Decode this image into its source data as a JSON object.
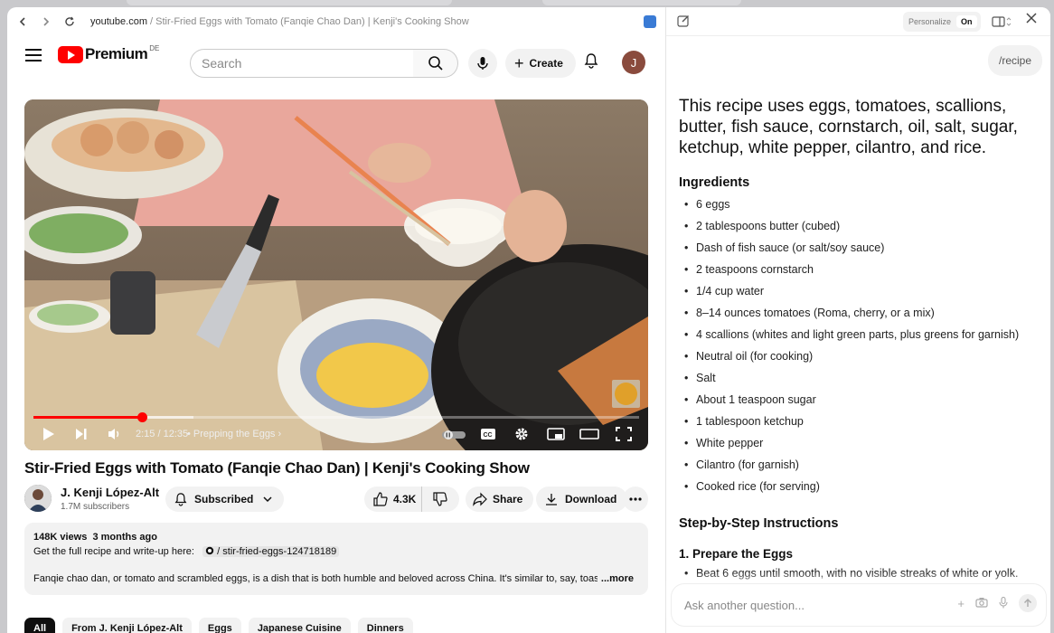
{
  "browser": {
    "url_host": "youtube.com",
    "url_path": " / Stir-Fried Eggs with Tomato (Fanqie Chao Dan) | Kenji's Cooking Show"
  },
  "youtube": {
    "brand": "Premium",
    "country": "DE",
    "search_placeholder": "Search",
    "create_label": "Create",
    "avatar_letter": "J",
    "player": {
      "time": "2:15 / 12:35",
      "chapter": "Prepping the Eggs",
      "progress_fraction": 0.179
    },
    "video_title": "Stir-Fried Eggs with Tomato (Fanqie Chao Dan) | Kenji's Cooking Show",
    "channel": {
      "name": "J. Kenji López-Alt",
      "subscribers": "1.7M subscribers",
      "subscribed_label": "Subscribed"
    },
    "actions": {
      "likes": "4.3K",
      "share": "Share",
      "download": "Download"
    },
    "description": {
      "views": "148K views",
      "age": "3 months ago",
      "line2_prefix": "Get the full recipe and write-up here:",
      "link": "/ stir-fried-eggs-124718189",
      "line3": "Fanqie chao dan, or tomato and scrambled eggs, is a dish that is both humble and beloved across China. It's similar to, say, toast in",
      "more": "...more"
    },
    "chips": [
      "All",
      "From J. Kenji López-Alt",
      "Eggs",
      "Japanese Cuisine",
      "Dinners"
    ]
  },
  "panel": {
    "personalize_label": "Personalize",
    "personalize_state": "On",
    "user_query": "/recipe",
    "answer": "This recipe uses eggs, tomatoes, scallions, butter, fish sauce, cornstarch, oil, salt, sugar, ketchup, white pepper, cilantro, and rice.",
    "ingredients_heading": "Ingredients",
    "ingredients": [
      "6 eggs",
      "2 tablespoons butter (cubed)",
      "Dash of fish sauce (or salt/soy sauce)",
      "2 teaspoons cornstarch",
      "1/4 cup water",
      "8–14 ounces tomatoes (Roma, cherry, or a mix)",
      "4 scallions (whites and light green parts, plus greens for garnish)",
      "Neutral oil (for cooking)",
      "Salt",
      "About 1 teaspoon sugar",
      "1 tablespoon ketchup",
      "White pepper",
      "Cilantro (for garnish)",
      "Cooked rice (for serving)"
    ],
    "steps_heading": "Step-by-Step Instructions",
    "step1_title": "1. Prepare the Eggs",
    "step1_item": "Beat 6 eggs until smooth, with no visible streaks of white or yolk.",
    "ask_placeholder": "Ask another question..."
  },
  "colors": {
    "youtube_red": "#ff0000",
    "progress_red": "#ff0000"
  }
}
